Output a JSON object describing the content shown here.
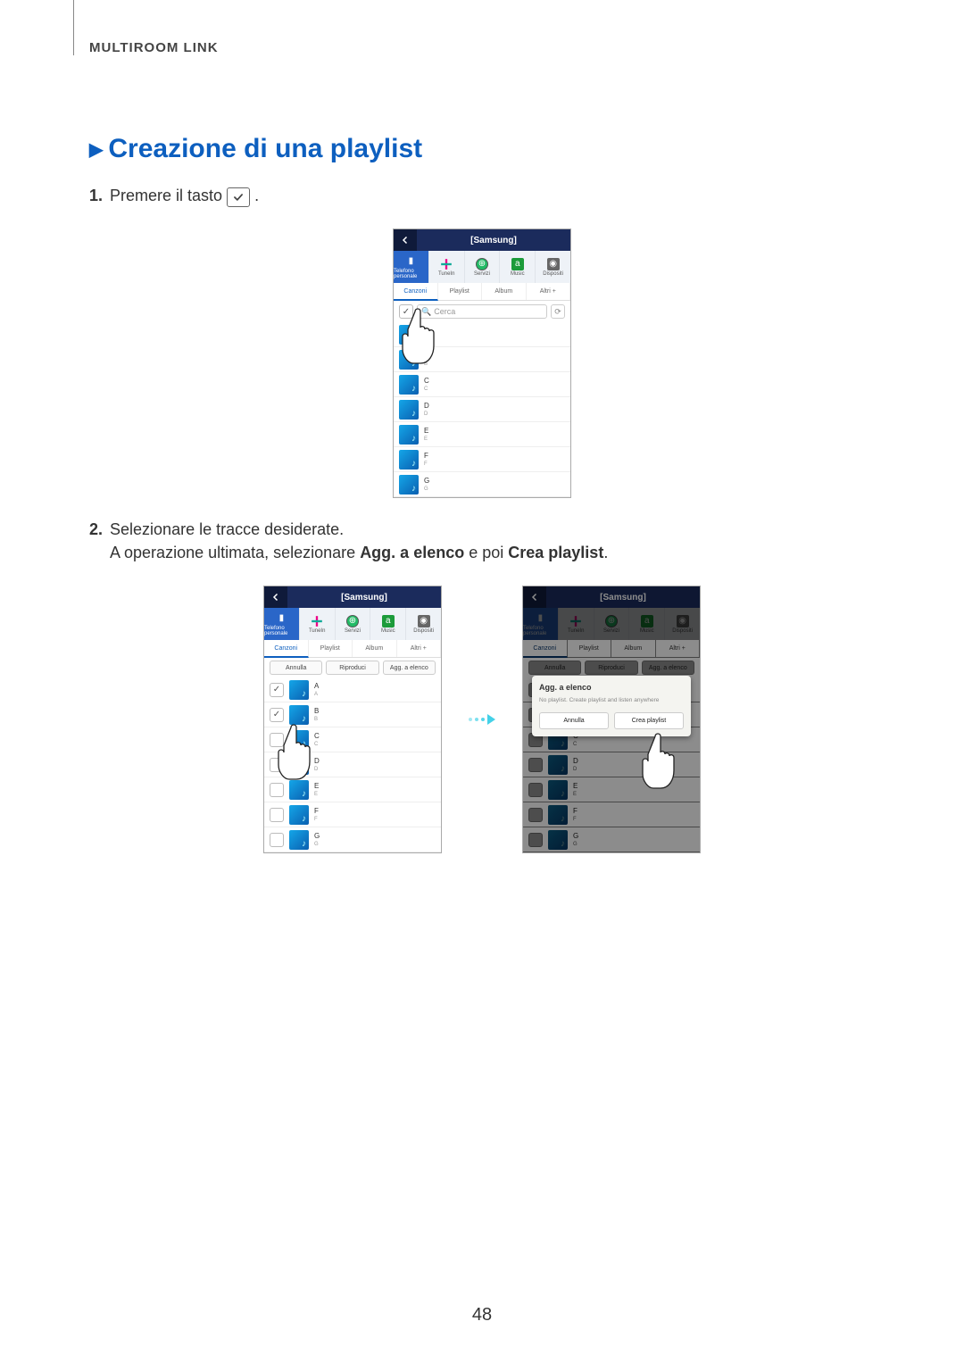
{
  "header": {
    "section": "MULTIROOM LINK"
  },
  "title": "Creazione di una playlist",
  "step1": {
    "num": "1.",
    "text_before": "Premere il tasto",
    "text_after": "."
  },
  "step2": {
    "num": "2.",
    "line1": "Selezionare le tracce desiderate.",
    "line2_a": "A operazione ultimata, selezionare ",
    "line2_b": "Agg. a elenco",
    "line2_c": " e poi ",
    "line2_d": "Crea playlist",
    "line2_e": "."
  },
  "phone": {
    "title": "[Samsung]",
    "sources": [
      {
        "label": "Telefono personale",
        "icon": "phone"
      },
      {
        "label": "TuneIn",
        "icon": "tunein"
      },
      {
        "label": "Servizi",
        "icon": "globe"
      },
      {
        "label": "Music",
        "icon": "amazon"
      },
      {
        "label": "Dispositi",
        "icon": "speaker"
      }
    ],
    "tabs": [
      "Canzoni",
      "Playlist",
      "Album",
      "Altri +"
    ],
    "search_placeholder": "Cerca",
    "actions": {
      "cancel": "Annulla",
      "play": "Riproduci",
      "add": "Agg. a elenco"
    },
    "tracks": [
      {
        "title": "A",
        "artist": "A"
      },
      {
        "title": "B",
        "artist": "B"
      },
      {
        "title": "C",
        "artist": "C"
      },
      {
        "title": "D",
        "artist": "D"
      },
      {
        "title": "E",
        "artist": "E"
      },
      {
        "title": "F",
        "artist": "F"
      },
      {
        "title": "G",
        "artist": "G"
      }
    ]
  },
  "modal": {
    "title": "Agg. a elenco",
    "body": "No playlist.\nCreate playlist and listen anywhere",
    "cancel": "Annulla",
    "create": "Crea playlist"
  },
  "page_number": "48"
}
